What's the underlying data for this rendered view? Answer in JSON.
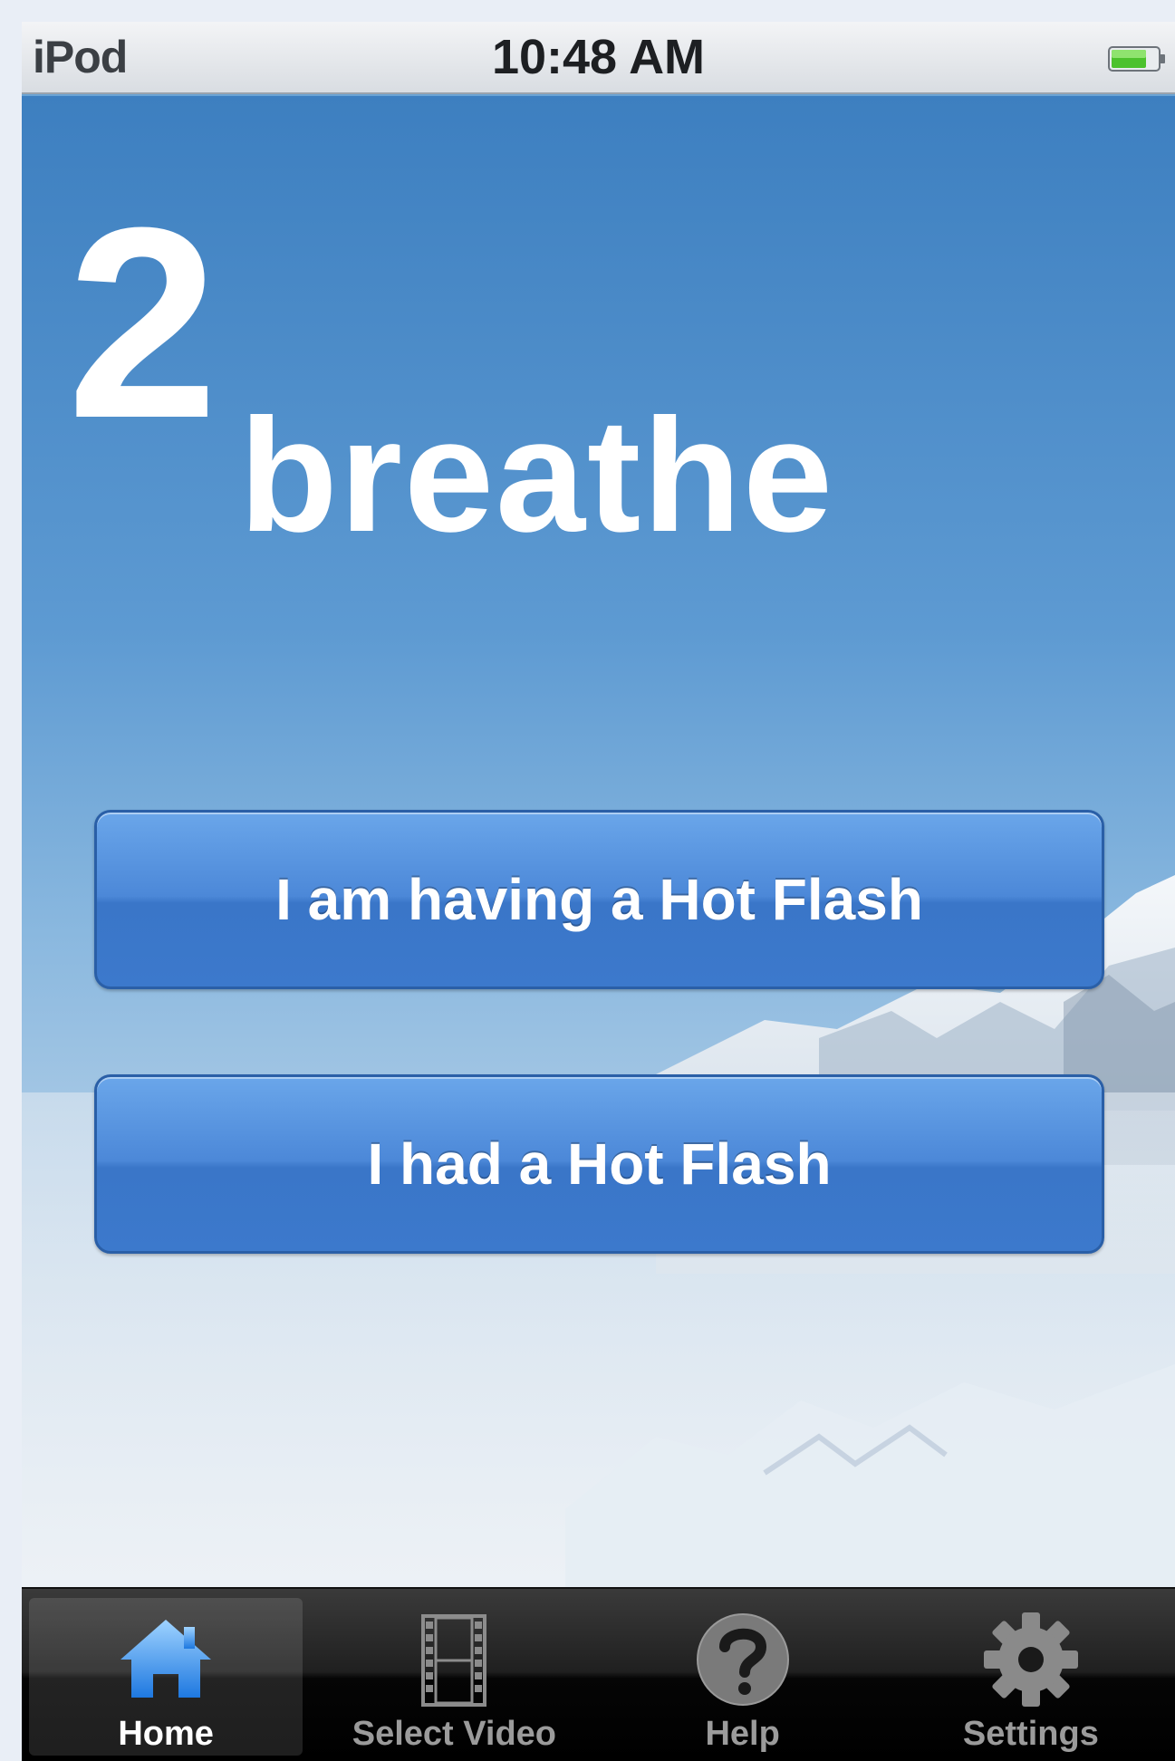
{
  "status_bar": {
    "carrier": "iPod",
    "time": "10:48 AM",
    "battery_icon": "battery-icon"
  },
  "logo": {
    "number": "2",
    "word": "breathe"
  },
  "actions": {
    "having": "I am having a Hot Flash",
    "had": "I had a Hot Flash"
  },
  "tab_bar": {
    "selected": "Home",
    "items": [
      {
        "label": "Home",
        "icon": "home-icon"
      },
      {
        "label": "Select Video",
        "icon": "film-icon"
      },
      {
        "label": "Help",
        "icon": "help-icon"
      },
      {
        "label": "Settings",
        "icon": "gear-icon"
      }
    ]
  },
  "colors": {
    "button": "#4c88d8",
    "sky_top": "#3f84c4",
    "sky_bottom": "#c8dcee"
  }
}
